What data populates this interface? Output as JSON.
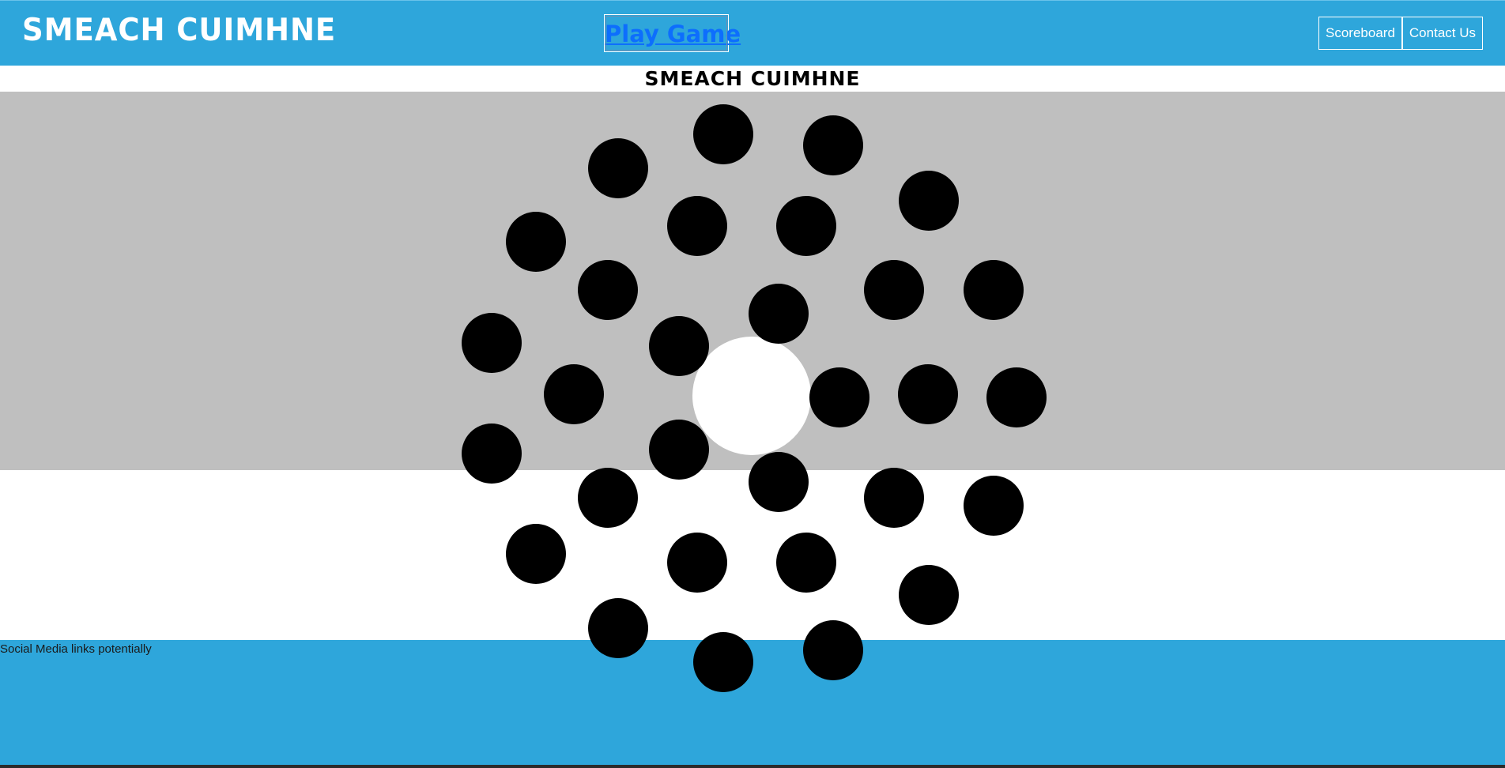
{
  "header": {
    "logo": "SMEACH CUIMHNE",
    "play_link": "Play Game",
    "nav": [
      {
        "label": "Scoreboard"
      },
      {
        "label": "Contact Us"
      }
    ]
  },
  "main": {
    "title": "SMEACH CUIMHNE",
    "dot_color": "#000000",
    "center_color": "#ffffff",
    "game_background": "#bfbfbf"
  },
  "footer": {
    "text": "Social Media links potentially"
  },
  "colors": {
    "brand_blue": "#2ea6db",
    "link_blue": "#0d6efd"
  }
}
